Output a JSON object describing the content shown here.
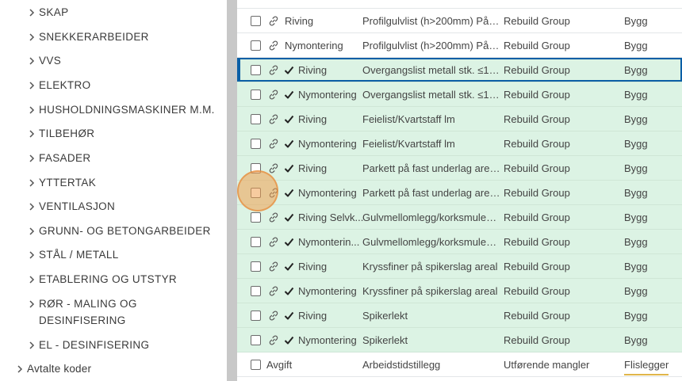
{
  "sidebar": {
    "items": [
      {
        "label": "SKAP"
      },
      {
        "label": "SNEKKERARBEIDER"
      },
      {
        "label": "VVS"
      },
      {
        "label": "ELEKTRO"
      },
      {
        "label": "HUSHOLDNINGSMASKINER M.M."
      },
      {
        "label": "TILBEHØR"
      },
      {
        "label": "FASADER"
      },
      {
        "label": "YTTERTAK"
      },
      {
        "label": "VENTILASJON"
      },
      {
        "label": "GRUNN- OG BETONGARBEIDER"
      },
      {
        "label": "STÅL / METALL"
      },
      {
        "label": "ETABLERING OG UTSTYR"
      },
      {
        "label": "RØR - MALING OG"
      },
      {
        "label": "EL - DESINFISERING"
      }
    ],
    "rør_line2": "DESINFISERING",
    "root_item": "Avtalte koder"
  },
  "table": {
    "rows": [
      {
        "type": "Riving",
        "desc": "Profilgulvlist (h>200mm) På t...",
        "group": "Rebuild Group",
        "category": "Bygg"
      },
      {
        "type": "Nymontering",
        "desc": "Profilgulvlist (h>200mm) På t...",
        "group": "Rebuild Group",
        "category": "Bygg"
      },
      {
        "type": "Riving",
        "desc": "Overgangslist metall stk. ≤1,...",
        "group": "Rebuild Group",
        "category": "Bygg"
      },
      {
        "type": "Nymontering",
        "desc": "Overgangslist metall stk. ≤1,...",
        "group": "Rebuild Group",
        "category": "Bygg"
      },
      {
        "type": "Riving",
        "desc": "Feielist/Kvartstaff lm",
        "group": "Rebuild Group",
        "category": "Bygg"
      },
      {
        "type": "Nymontering",
        "desc": "Feielist/Kvartstaff lm",
        "group": "Rebuild Group",
        "category": "Bygg"
      },
      {
        "type": "Riving",
        "desc": "Parkett på fast underlag area...",
        "group": "Rebuild Group",
        "category": "Bygg"
      },
      {
        "type": "Nymontering",
        "desc": "Parkett på fast underlag area...",
        "group": "Rebuild Group",
        "category": "Bygg"
      },
      {
        "type": "Riving Selvk...",
        "desc": "Gulvmellomlegg/korksmulep...",
        "group": "Rebuild Group",
        "category": "Bygg"
      },
      {
        "type": "Nymonterin...",
        "desc": "Gulvmellomlegg/korksmulep...",
        "group": "Rebuild Group",
        "category": "Bygg"
      },
      {
        "type": "Riving",
        "desc": "Kryssfiner på spikerslag areal",
        "group": "Rebuild Group",
        "category": "Bygg"
      },
      {
        "type": "Nymontering",
        "desc": "Kryssfiner på spikerslag areal",
        "group": "Rebuild Group",
        "category": "Bygg"
      },
      {
        "type": "Riving",
        "desc": "Spikerlekt",
        "group": "Rebuild Group",
        "category": "Bygg"
      },
      {
        "type": "Nymontering",
        "desc": "Spikerlekt",
        "group": "Rebuild Group",
        "category": "Bygg"
      },
      {
        "type": "Avgift",
        "desc": "Arbeidstidstillegg",
        "group": "Utførende mangler",
        "category": "Flislegger"
      }
    ]
  },
  "colors": {
    "selected_row_bg": "#dcf3e4",
    "active_border": "#0b5fa6",
    "divider": "#c8c8c8"
  }
}
